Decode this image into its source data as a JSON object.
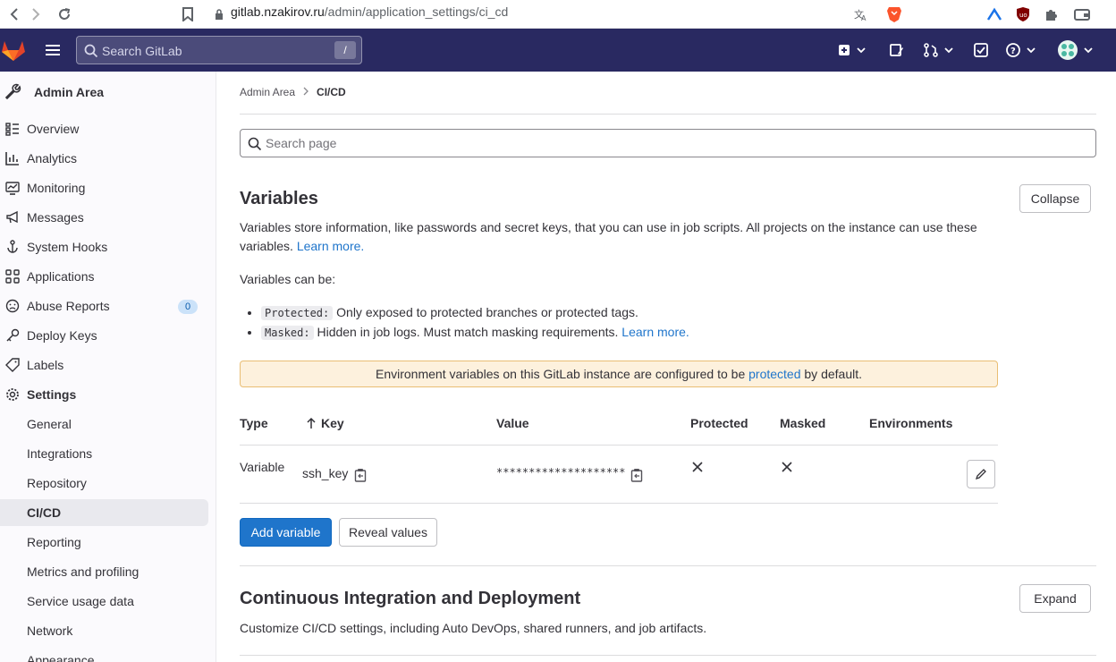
{
  "browser": {
    "url_host": "gitlab.nzakirov.ru",
    "url_path": "/admin/application_settings/ci_cd"
  },
  "topnav": {
    "search_placeholder": "Search GitLab",
    "search_shortcut": "/"
  },
  "sidebar": {
    "title": "Admin Area",
    "items": [
      {
        "label": "Overview",
        "icon": "overview-icon"
      },
      {
        "label": "Analytics",
        "icon": "chart-icon"
      },
      {
        "label": "Monitoring",
        "icon": "monitor-icon"
      },
      {
        "label": "Messages",
        "icon": "bullhorn-icon"
      },
      {
        "label": "System Hooks",
        "icon": "hook-icon"
      },
      {
        "label": "Applications",
        "icon": "applications-icon"
      },
      {
        "label": "Abuse Reports",
        "icon": "abuse-icon",
        "badge": "0"
      },
      {
        "label": "Deploy Keys",
        "icon": "key-icon"
      },
      {
        "label": "Labels",
        "icon": "label-icon"
      },
      {
        "label": "Settings",
        "icon": "settings-icon"
      }
    ],
    "settings_sub": [
      "General",
      "Integrations",
      "Repository",
      "CI/CD",
      "Reporting",
      "Metrics and profiling",
      "Service usage data",
      "Network",
      "Appearance"
    ]
  },
  "breadcrumb": {
    "parent": "Admin Area",
    "current": "CI/CD"
  },
  "page_search_placeholder": "Search page",
  "variables": {
    "title": "Variables",
    "collapse_label": "Collapse",
    "desc": "Variables store information, like passwords and secret keys, that you can use in job scripts. All projects on the instance can use these",
    "desc2": "variables.",
    "learn_more": "Learn more.",
    "can_be": "Variables can be:",
    "protected_code": "Protected:",
    "protected_text": "Only exposed to protected branches or protected tags.",
    "masked_code": "Masked:",
    "masked_text": "Hidden in job logs. Must match masking requirements.",
    "alert_pre": "Environment variables on this GitLab instance are configured to be",
    "alert_link": "protected",
    "alert_post": "by default.",
    "columns": [
      "Type",
      "Key",
      "Value",
      "Protected",
      "Masked",
      "Environments"
    ],
    "row": {
      "type": "Variable",
      "key": "ssh_key",
      "value": "********************"
    },
    "add_label": "Add variable",
    "reveal_label": "Reveal values"
  },
  "cicd": {
    "title": "Continuous Integration and Deployment",
    "expand_label": "Expand",
    "desc": "Customize CI/CD settings, including Auto DevOps, shared runners, and job artifacts."
  },
  "colors": {
    "nav_bg": "#292961",
    "primary": "#1f75cb",
    "alert_bg": "#fdf1dd"
  }
}
